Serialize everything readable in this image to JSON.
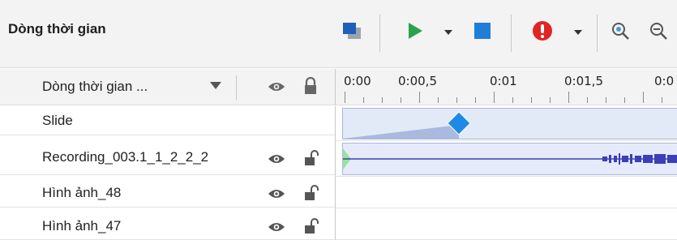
{
  "header": {
    "title": "Dòng thời gian",
    "icons": [
      "layer-color-icon",
      "play-icon",
      "play-dropdown-icon",
      "stop-icon",
      "record-icon",
      "record-dropdown-icon",
      "zoom-in-icon",
      "zoom-out-icon"
    ]
  },
  "track_header": {
    "label": "Dòng thời gian ...",
    "icons": [
      "dropdown-icon",
      "eye-icon",
      "lock-icon"
    ]
  },
  "ruler": {
    "labels": [
      "0:00",
      "0:00,5",
      "0:01",
      "0:01,5",
      "0:0"
    ]
  },
  "tracks": [
    {
      "label": "Slide"
    },
    {
      "label": "Recording_003.1_1_2_2_2"
    },
    {
      "label": "Hình ảnh_48"
    },
    {
      "label": "Hình ảnh_47"
    }
  ],
  "colors": {
    "accent_blue": "#1f7fd6",
    "play_green": "#2aa34a",
    "record_red": "#e02424",
    "clip_fill": "#e2eaf8",
    "waveform": "#3b3fb8"
  }
}
